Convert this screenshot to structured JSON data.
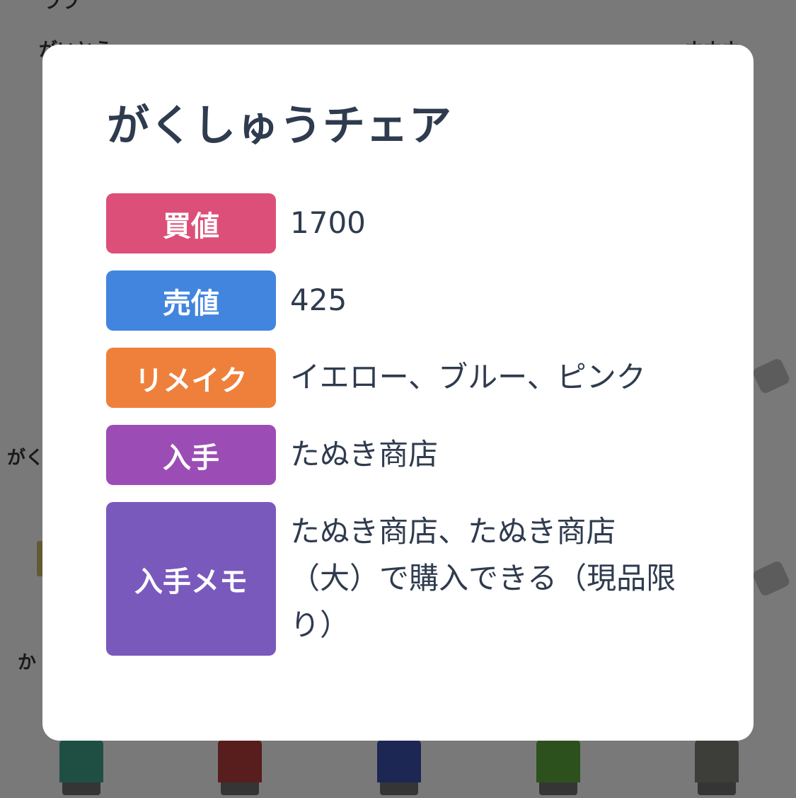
{
  "background": {
    "texts": [
      "ララ",
      "がいとう",
      "ホホホ",
      "がく",
      "か"
    ],
    "colors": {
      "item_1": "#3f9f86",
      "item_2": "#b03a3a",
      "item_3": "#3a4fa8",
      "item_4": "#5aa33a",
      "item_5": "#7a7a72"
    }
  },
  "modal": {
    "title": "がくしゅうチェア",
    "rows": [
      {
        "label": "買値",
        "value": "1700",
        "color": "#dc4f79"
      },
      {
        "label": "売値",
        "value": "425",
        "color": "#4285de"
      },
      {
        "label": "リメイク",
        "value": "イエロー、ブルー、ピンク",
        "color": "#ee803c"
      },
      {
        "label": "入手",
        "value": "たぬき商店",
        "color": "#9b4db5"
      },
      {
        "label": "入手メモ",
        "value": "たぬき商店、たぬき商店（大）で購入できる（現品限り）",
        "color": "#7a59bd"
      }
    ]
  }
}
